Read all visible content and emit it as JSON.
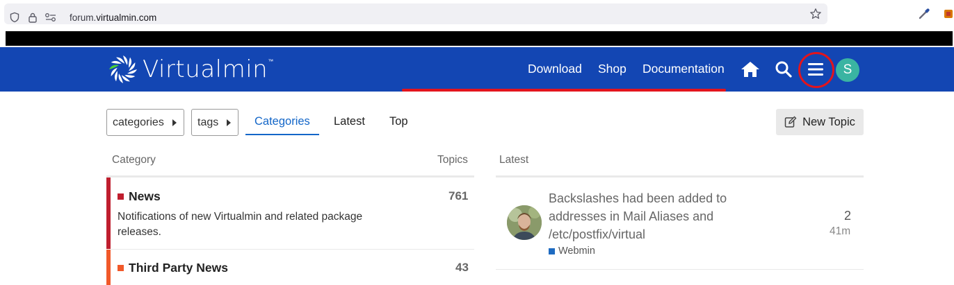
{
  "browser": {
    "url_prefix": "forum.",
    "url_host": "virtualmin.com"
  },
  "header": {
    "logo_text": "Virtualmin",
    "logo_tm": "™",
    "nav": [
      "Download",
      "Shop",
      "Documentation"
    ],
    "avatar_letter": "S",
    "colors": {
      "bar": "#1346b3",
      "avatar": "#3ab4a2",
      "annotation": "#e3141c"
    }
  },
  "toolbar": {
    "categories_dropdown": "categories",
    "tags_dropdown": "tags",
    "tabs": [
      "Categories",
      "Latest",
      "Top"
    ],
    "active_tab": "Categories",
    "new_topic": "New Topic"
  },
  "categories": {
    "col_category": "Category",
    "col_topics": "Topics",
    "items": [
      {
        "name": "News",
        "color": "#bf1e2e",
        "description": "Notifications of new Virtualmin and related package releases.",
        "topics": "761"
      },
      {
        "name": "Third Party News",
        "color": "#f1592a",
        "description": "",
        "topics": "43"
      }
    ]
  },
  "latest": {
    "col_latest": "Latest",
    "topics": [
      {
        "title": "Backslashes had been added to addresses in Mail Aliases and /etc/postfix/virtual",
        "category": "Webmin",
        "category_color": "#1e6bc1",
        "posts": "2",
        "age": "41m"
      }
    ]
  }
}
